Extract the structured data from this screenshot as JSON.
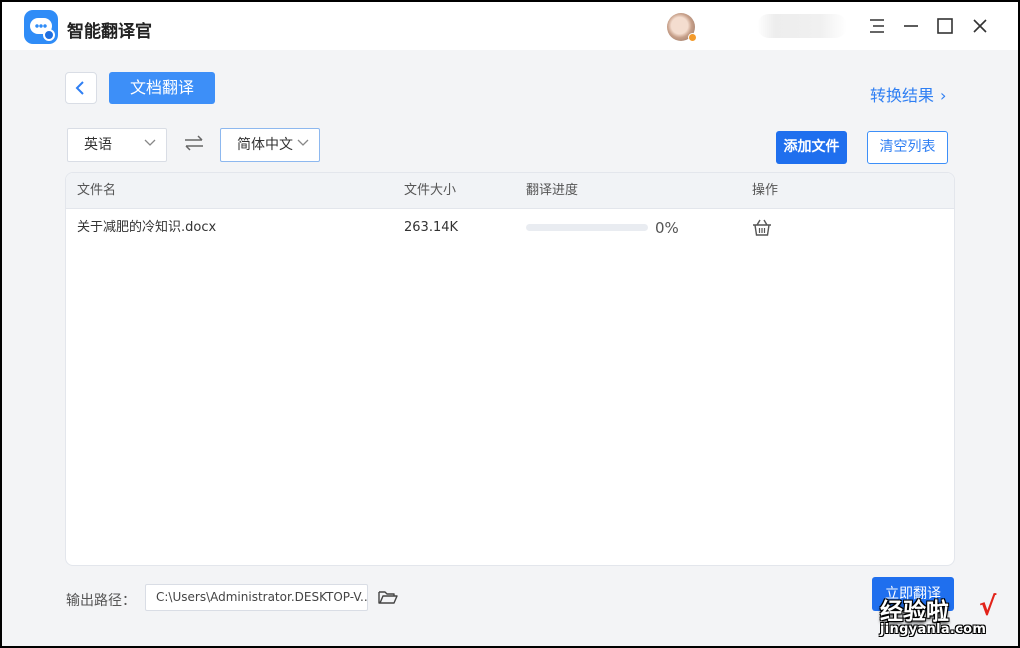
{
  "app": {
    "title": "智能翻译官"
  },
  "toolbar": {
    "active_tab": "文档翻译",
    "results_link": "转换结果",
    "results_chevron": "›"
  },
  "languages": {
    "source": "英语",
    "target": "简体中文"
  },
  "actions": {
    "add_file": "添加文件",
    "clear_list": "清空列表",
    "translate_now": "立即翻译"
  },
  "table": {
    "headers": {
      "name": "文件名",
      "size": "文件大小",
      "progress": "翻译进度",
      "action": "操作"
    },
    "rows": [
      {
        "name": "关于减肥的冷知识.docx",
        "size": "263.14K",
        "progress_fraction": 0,
        "progress_text": "0%",
        "action_icon": "delete-basket-icon"
      }
    ]
  },
  "output": {
    "label": "输出路径：",
    "path": "C:\\Users\\Administrator.DESKTOP-V..."
  },
  "watermark": {
    "text": "经验啦",
    "check": "√",
    "url": "jingyanla.com"
  },
  "colors": {
    "accent": "#1f6fee",
    "accent_light": "#3d8ff8",
    "link": "#2f7ff3",
    "background": "#f3f4f6"
  }
}
